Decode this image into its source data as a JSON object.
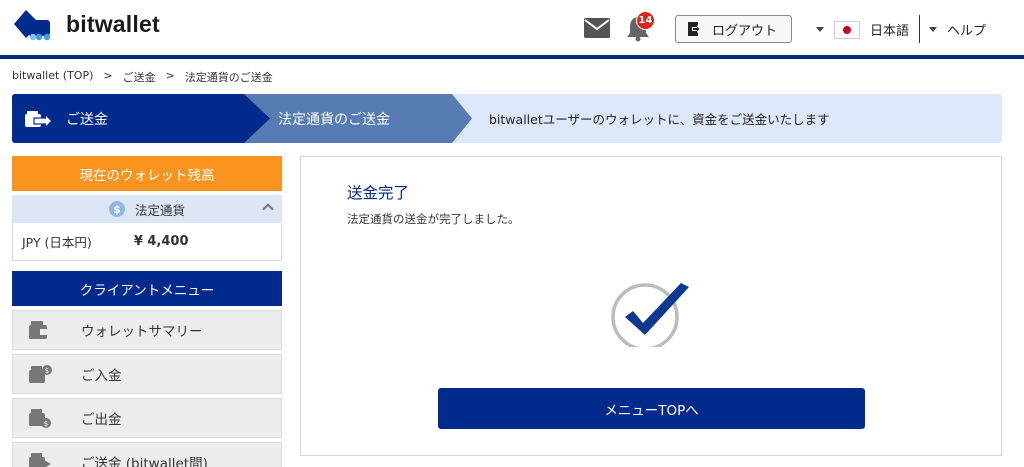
{
  "header": {
    "logo_text": "bitwallet",
    "notification_count": "14",
    "logout_label": "ログアウト",
    "language_label": "日本語",
    "help_label": "ヘルプ"
  },
  "breadcrumb": {
    "items": [
      "bitwallet (TOP)",
      ">",
      "ご送金",
      ">",
      "法定通貨のご送金"
    ]
  },
  "steps": {
    "step1": "ご送金",
    "step2": "法定通貨のご送金",
    "description": "bitwalletユーザーのウォレットに、資金をご送金いたします"
  },
  "sidebar": {
    "wallet_heading": "現在のウォレット残高",
    "currency_label": "法定通貨",
    "coin_symbol": "$",
    "balance_currency": "JPY (日本円)",
    "balance_amount": "¥ 4,400",
    "menu_heading": "クライアントメニュー",
    "menu_items": [
      "ウォレットサマリー",
      "ご入金",
      "ご出金",
      "ご送金 (bitwallet間)"
    ]
  },
  "main": {
    "title": "送金完了",
    "message": "法定通貨の送金が完了しました。",
    "button_label": "メニューTOPへ"
  },
  "colors": {
    "brand_navy": "#002a8c",
    "step2_blue": "#577bb3",
    "banner_bg": "#dde7fa",
    "wallet_orange": "#f99421",
    "badge_red": "#d9261c"
  }
}
